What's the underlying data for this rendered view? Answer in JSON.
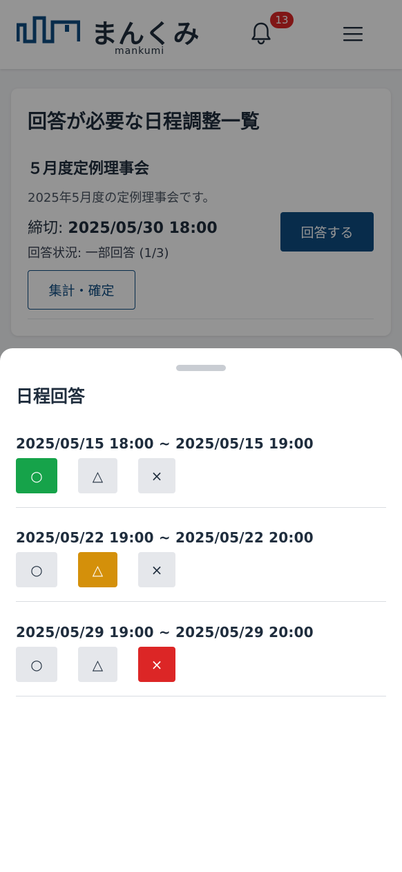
{
  "header": {
    "logo_text": "まんくみ",
    "logo_sub": "mankumi",
    "notification_count": "13",
    "bell_icon": "bell-icon",
    "menu_icon": "hamburger-menu-icon"
  },
  "card": {
    "title": "回答が必要な日程調整一覧",
    "event_title": "５月度定例理事会",
    "event_description": "2025年5月度の定例理事会です。",
    "deadline_label": "締切: ",
    "deadline_value": "2025/05/30 18:00",
    "status": "回答状況: 一部回答 (1/3)",
    "answer_button": "回答する",
    "aggregate_button": "集計・確定"
  },
  "sheet": {
    "title": "日程回答",
    "options": [
      "○",
      "△",
      "×"
    ],
    "slots": [
      {
        "time": "2025/05/15 18:00 ~ 2025/05/15 19:00",
        "selected": "○"
      },
      {
        "time": "2025/05/22 19:00 ~ 2025/05/22 20:00",
        "selected": "△"
      },
      {
        "time": "2025/05/29 19:00 ~ 2025/05/29 20:00",
        "selected": "×"
      }
    ]
  },
  "colors": {
    "primary": "#0f4c81",
    "ok": "#16a34a",
    "maybe": "#d4900a",
    "no": "#dc2626",
    "badge": "#dc2626"
  }
}
